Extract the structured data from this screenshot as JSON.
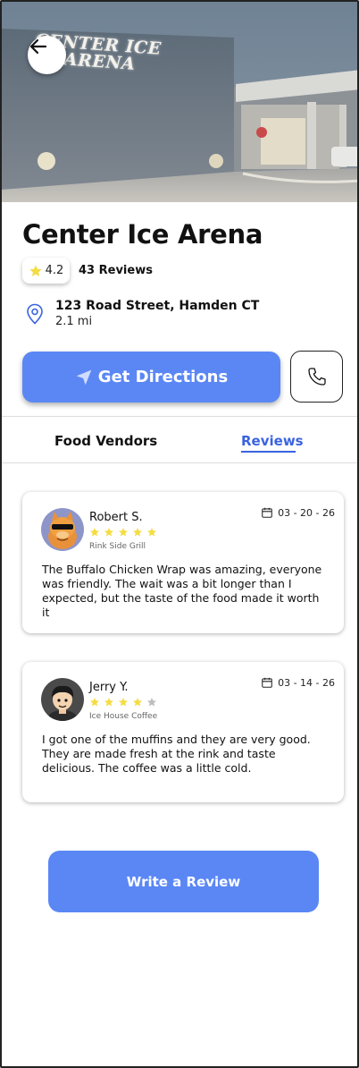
{
  "hero": {
    "sign_line1": "CENTER ICE",
    "sign_line2": "ARENA"
  },
  "venue": {
    "title": "Center Ice Arena",
    "rating": "4.2",
    "reviews_count": "43 Reviews",
    "address": "123 Road Street, Hamden CT",
    "distance": "2.1 mi"
  },
  "actions": {
    "directions_label": "Get Directions",
    "write_review_label": "Write a Review"
  },
  "tabs": [
    {
      "label": "Food Vendors",
      "active": false
    },
    {
      "label": "Reviews",
      "active": true
    }
  ],
  "reviews": [
    {
      "name": "Robert S.",
      "rating": 5,
      "vendor": "Rink Side Grill",
      "date": "03 - 20 - 26",
      "text": "The Buffalo Chicken Wrap was amazing, everyone was friendly. The wait was a bit longer than I expected, but the taste of the food made it worth it"
    },
    {
      "name": "Jerry Y.",
      "rating": 4,
      "vendor": "Ice House Coffee",
      "date": "03 - 14 - 26",
      "text": "I got one of the muffins and they are very good. They are made fresh at the rink and taste delicious. The coffee was a little cold."
    }
  ],
  "colors": {
    "accent": "#5b87f5",
    "tab_active": "#3a63e0",
    "star_filled": "#f5dc42",
    "star_empty": "#bdbdbd"
  },
  "icons": {
    "back": "arrow-left-icon",
    "rating_star": "star-icon",
    "location": "map-pin-icon",
    "directions": "navigation-icon",
    "phone": "phone-icon",
    "date": "calendar-icon"
  }
}
